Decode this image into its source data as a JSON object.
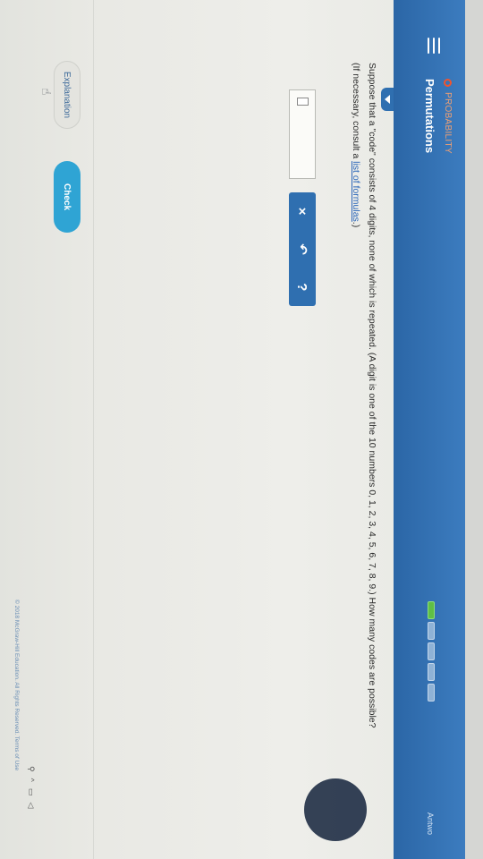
{
  "header": {
    "category": "PROBABILITY",
    "topic": "Permutations",
    "right_label": "Antwo",
    "progress": {
      "completed": 1,
      "total": 5
    },
    "colors": {
      "bar": "#2f6fb0",
      "progress_done": "#5fbf46",
      "category": "#f2542d"
    }
  },
  "question": {
    "text": "Suppose that a \"code\" consists of 4 digits, none of which is repeated. (A digit is one of the 10 numbers 0, 1, 2, 3, 4, 5, 6, 7, 8, 9.) How many codes are possible?",
    "note_prefix": "(If necessary, consult a ",
    "note_link": "list of formulas",
    "note_suffix": ".)"
  },
  "tools": {
    "clear": "×",
    "undo": "↶",
    "help": "?"
  },
  "footer": {
    "explanation_label": "Explanation",
    "check_label": "Check",
    "copyright": "© 2018 McGraw-Hill Education. All Rights Reserved.   Terms of Use",
    "colors": {
      "check": "#2fa4d4"
    }
  }
}
